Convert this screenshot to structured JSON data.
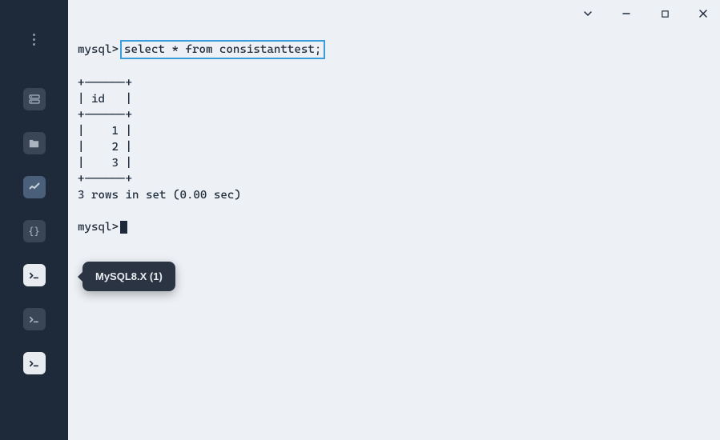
{
  "tooltip": {
    "text": "MySQL8.X (1)"
  },
  "terminal": {
    "prompt1": "mysql>",
    "query": "select * from consistanttest;",
    "border1": "+------+",
    "header": "| id   |",
    "border2": "+------+",
    "row1": "|    1 |",
    "row2": "|    2 |",
    "row3": "|    3 |",
    "border3": "+------+",
    "footer": "3 rows in set (0.00 sec)",
    "prompt2": "mysql>"
  }
}
